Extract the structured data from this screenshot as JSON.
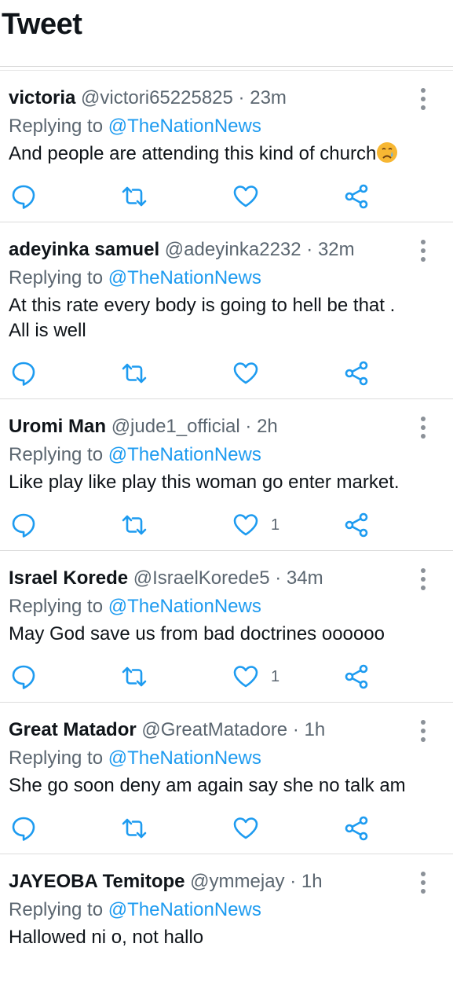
{
  "header": {
    "title": "Tweet"
  },
  "reply_prefix": "Replying to",
  "tweets": [
    {
      "name": "victoria",
      "handle": "@victori65225825",
      "time": "23m",
      "replying_to": "@TheNationNews",
      "text": "And people are attending this kind of church",
      "emoji": "sad-face-emoji",
      "likes": ""
    },
    {
      "name": "adeyinka samuel",
      "handle": "@adeyinka2232",
      "time": "32m",
      "replying_to": "@TheNationNews",
      "text": "At this rate every body is going to hell be that . All is well",
      "likes": ""
    },
    {
      "name": "Uromi Man",
      "handle": "@jude1_official",
      "time": "2h",
      "replying_to": "@TheNationNews",
      "text": "Like play like play this woman go enter market.",
      "likes": "1"
    },
    {
      "name": "Israel Korede",
      "handle": "@IsraelKorede5",
      "time": "34m",
      "replying_to": "@TheNationNews",
      "text": "May God save us from bad doctrines oooooo",
      "likes": "1"
    },
    {
      "name": "Great Matador",
      "handle": "@GreatMatadore",
      "time": "1h",
      "replying_to": "@TheNationNews",
      "text": "She go soon deny am again say she no talk am",
      "likes": ""
    },
    {
      "name": "JAYEOBA Temitope",
      "handle": "@ymmejay",
      "time": "1h",
      "replying_to": "@TheNationNews",
      "text": "Hallowed ni o, not hallo",
      "likes": ""
    }
  ],
  "colors": {
    "accent": "#1d9bf0",
    "muted": "#5b6670",
    "icon": "#1d9bf0"
  }
}
